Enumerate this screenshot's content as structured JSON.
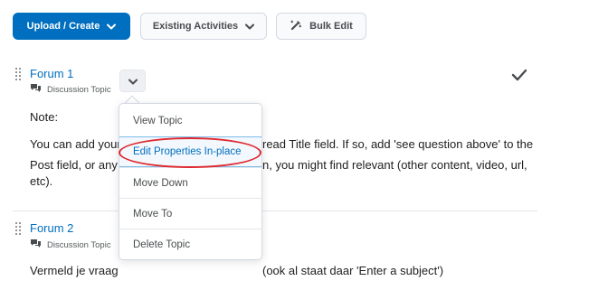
{
  "toolbar": {
    "upload_label": "Upload / Create",
    "existing_label": "Existing Activities",
    "bulk_label": "Bulk Edit"
  },
  "items": [
    {
      "title": "Forum 1",
      "type_label": "Discussion Topic",
      "note_label": "Note:",
      "body_lines": [
        "You can add your",
        "read Title field. If so, add 'see question above' to the",
        "Post field, or any",
        "n, you might find relevant (other content, video, url,",
        "etc)."
      ]
    },
    {
      "title": "Forum 2",
      "type_label": "Discussion Topic",
      "body_lines": [
        "Vermeld je vraag",
        "(ook al staat daar 'Enter a subject')"
      ]
    }
  ],
  "context_menu": {
    "items": [
      "View Topic",
      "Edit Properties In-place",
      "Move Down",
      "Move To",
      "Delete Topic"
    ],
    "active_index": 1
  },
  "colors": {
    "primary": "#006fbf",
    "link": "#006fbf",
    "highlight_ellipse": "#e0282f",
    "text": "#202122"
  },
  "icons": {
    "upload_chevron": "chevron-down-icon",
    "existing_chevron": "chevron-down-icon",
    "bulk": "bulk-edit-icon",
    "item_type": "discussion-icon",
    "status": "checkmark-icon",
    "drag": "drag-handle-icon"
  }
}
